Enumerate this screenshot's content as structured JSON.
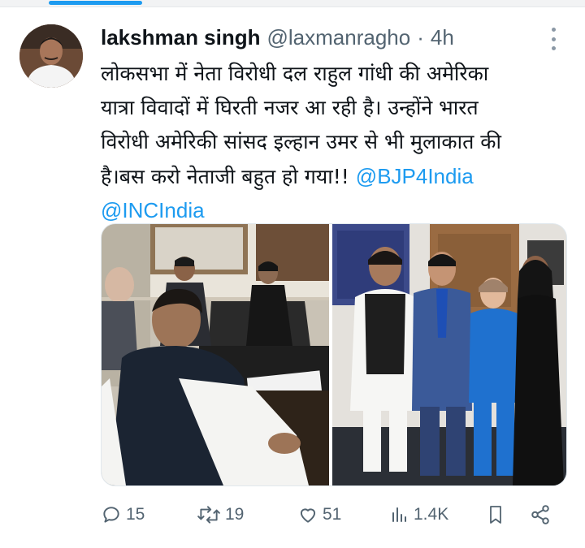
{
  "tweet": {
    "author_name": "lakshman singh",
    "handle": "@laxmanragho",
    "separator": "·",
    "time": "4h",
    "text_lines": [
      "लोकसभा में नेता विरोधी दल राहुल गांधी की अमेरिका",
      "यात्रा विवादों में घिरती नजर आ रही है। उन्होंने भारत",
      "विरोधी अमेरिकी सांसद इल्हान उमर से भी मुलाकात की",
      "है।बस करो नेताजी बहुत हो गया!!"
    ],
    "mentions": [
      "@BJP4India",
      "@INCIndia"
    ]
  },
  "stats": {
    "replies": "15",
    "reposts": "19",
    "likes": "51",
    "views": "1.4K"
  },
  "icons": {
    "reply": "reply-icon",
    "repost": "repost-icon",
    "like": "like-icon",
    "views": "views-icon",
    "bookmark": "bookmark-icon",
    "share": "share-icon",
    "more": "more-icon"
  },
  "colors": {
    "accent": "#1d9bf0",
    "text": "#0f1419",
    "muted": "#536471"
  }
}
